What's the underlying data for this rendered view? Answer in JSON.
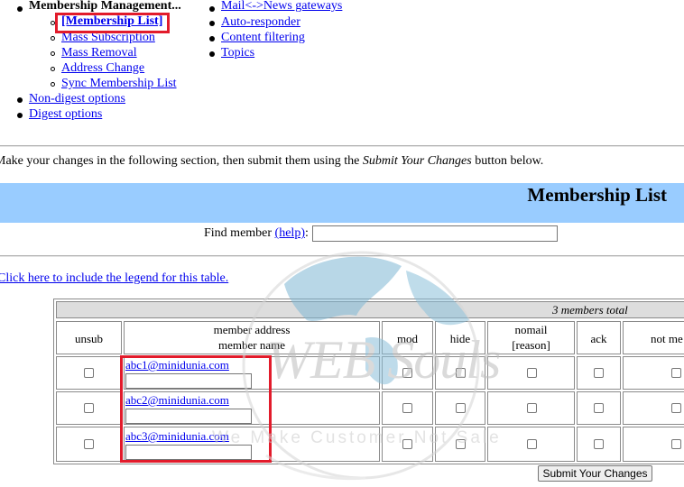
{
  "nav": {
    "membership_heading": "Membership Management...",
    "membership_items": [
      "[Membership List]",
      "Mass Subscription",
      "Mass Removal",
      "Address Change",
      "Sync Membership List"
    ],
    "other_items": [
      "Non-digest options",
      "Digest options"
    ],
    "right_items": [
      "Mail<->News gateways",
      "Auto-responder",
      "Content filtering",
      "Topics"
    ]
  },
  "instructions": {
    "before": "Make your changes in the following section, then submit them using the ",
    "emphasis": "Submit Your Changes",
    "after": " button below."
  },
  "section_title": "Membership List",
  "find": {
    "label_before": "Find member ",
    "help_link": "(help)",
    "label_after": ":",
    "value": ""
  },
  "legend_link": "Click here to include the legend for this table.",
  "table": {
    "total_text": "3 members total",
    "headers": {
      "unsub": "unsub",
      "address_line1": "member address",
      "address_line2": "member name",
      "mod": "mod",
      "hide": "hide",
      "nomail_line1": "nomail",
      "nomail_line2": "[reason]",
      "ack": "ack",
      "notme": "not me"
    },
    "members": [
      {
        "email": "abc1@minidunia.com",
        "name": ""
      },
      {
        "email": "abc2@minidunia.com",
        "name": ""
      },
      {
        "email": "abc3@minidunia.com",
        "name": ""
      }
    ]
  },
  "submit_label": "Submit Your Changes",
  "watermark": {
    "brand": "WEB Souls",
    "tagline": "We Make Customer Not Sale"
  },
  "colors": {
    "highlight": "#e21b2b",
    "section_bg": "#99ccff",
    "link": "#0000ee",
    "table_header_bg": "#dddddd"
  }
}
